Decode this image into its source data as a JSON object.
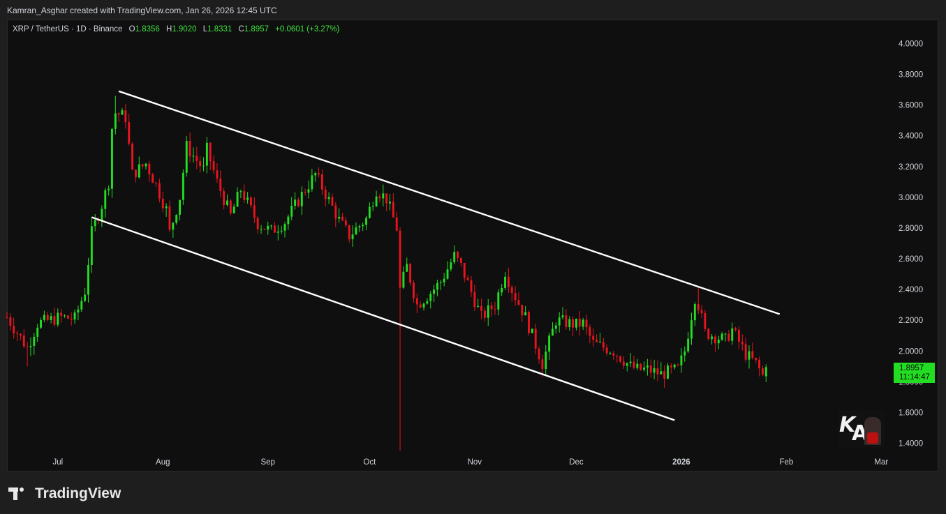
{
  "header": {
    "caption": "Kamran_Asghar created with TradingView.com, Jan 26, 2026 12:45 UTC"
  },
  "legend": {
    "symbol": "XRP / TetherUS · 1D · Binance",
    "open_label": "O",
    "open": "1.8356",
    "high_label": "H",
    "high": "1.9020",
    "low_label": "L",
    "low": "1.8331",
    "close_label": "C",
    "close": "1.8957",
    "change": "+0.0601 (+3.27%)"
  },
  "price_tag": {
    "price": "1.8957",
    "countdown": "11:14:47"
  },
  "watermark": {
    "text": "KAMRAN ASGHAR"
  },
  "brand": {
    "name": "TradingView"
  },
  "colors": {
    "up": "#22dd22",
    "down": "#e8141e",
    "background": "#0f0f0f",
    "channel": "#ffffff",
    "axis_text": "#d1d4dc"
  },
  "chart_data": {
    "type": "candlestick",
    "ylim": [
      1.3,
      4.1
    ],
    "y_ticks": [
      "4.0000",
      "3.8000",
      "3.6000",
      "3.4000",
      "3.2000",
      "3.0000",
      "2.8000",
      "2.6000",
      "2.4000",
      "2.2000",
      "2.0000",
      "1.8000",
      "1.6000",
      "1.4000"
    ],
    "x_ticks": [
      {
        "label": "Jul",
        "date": "2025-07-01"
      },
      {
        "label": "Aug",
        "date": "2025-08-01"
      },
      {
        "label": "Sep",
        "date": "2025-09-01"
      },
      {
        "label": "Oct",
        "date": "2025-10-01"
      },
      {
        "label": "Nov",
        "date": "2025-11-01"
      },
      {
        "label": "Dec",
        "date": "2025-12-01"
      },
      {
        "label": "2026",
        "date": "2026-01-01"
      },
      {
        "label": "Feb",
        "date": "2026-02-01"
      },
      {
        "label": "Mar",
        "date": "2026-03-01"
      }
    ],
    "x_range": [
      "2025-06-16",
      "2026-03-03"
    ],
    "close_anchors": [
      [
        "2025-06-16",
        2.22
      ],
      [
        "2025-06-22",
        2.02
      ],
      [
        "2025-06-25",
        2.18
      ],
      [
        "2025-07-02",
        2.22
      ],
      [
        "2025-07-06",
        2.21
      ],
      [
        "2025-07-09",
        2.39
      ],
      [
        "2025-07-11",
        2.77
      ],
      [
        "2025-07-14",
        2.95
      ],
      [
        "2025-07-16",
        3.1
      ],
      [
        "2025-07-17",
        3.45
      ],
      [
        "2025-07-18",
        3.55
      ],
      [
        "2025-07-21",
        3.52
      ],
      [
        "2025-07-23",
        3.15
      ],
      [
        "2025-07-27",
        3.22
      ],
      [
        "2025-07-30",
        3.08
      ],
      [
        "2025-08-02",
        2.92
      ],
      [
        "2025-08-03",
        2.77
      ],
      [
        "2025-08-06",
        3.0
      ],
      [
        "2025-08-08",
        3.33
      ],
      [
        "2025-08-13",
        3.18
      ],
      [
        "2025-08-14",
        3.31
      ],
      [
        "2025-08-17",
        3.1
      ],
      [
        "2025-08-21",
        2.88
      ],
      [
        "2025-08-24",
        3.05
      ],
      [
        "2025-08-29",
        2.83
      ],
      [
        "2025-09-02",
        2.78
      ],
      [
        "2025-09-06",
        2.84
      ],
      [
        "2025-09-12",
        3.05
      ],
      [
        "2025-09-15",
        3.15
      ],
      [
        "2025-09-19",
        2.98
      ],
      [
        "2025-09-22",
        2.85
      ],
      [
        "2025-09-25",
        2.75
      ],
      [
        "2025-09-30",
        2.86
      ],
      [
        "2025-10-03",
        3.05
      ],
      [
        "2025-10-06",
        2.99
      ],
      [
        "2025-10-09",
        2.8
      ],
      [
        "2025-10-10",
        2.4
      ],
      [
        "2025-10-12",
        2.55
      ],
      [
        "2025-10-15",
        2.3
      ],
      [
        "2025-10-19",
        2.38
      ],
      [
        "2025-10-22",
        2.45
      ],
      [
        "2025-10-26",
        2.62
      ],
      [
        "2025-10-28",
        2.55
      ],
      [
        "2025-11-03",
        2.22
      ],
      [
        "2025-11-07",
        2.3
      ],
      [
        "2025-11-10",
        2.52
      ],
      [
        "2025-11-12",
        2.4
      ],
      [
        "2025-11-16",
        2.22
      ],
      [
        "2025-11-21",
        1.92
      ],
      [
        "2025-11-25",
        2.2
      ],
      [
        "2025-12-01",
        2.17
      ],
      [
        "2025-12-03",
        2.18
      ],
      [
        "2025-12-06",
        2.05
      ],
      [
        "2025-12-12",
        2.0
      ],
      [
        "2025-12-17",
        1.9
      ],
      [
        "2025-12-19",
        1.88
      ],
      [
        "2025-12-22",
        1.88
      ],
      [
        "2025-12-26",
        1.85
      ],
      [
        "2025-12-31",
        1.88
      ],
      [
        "2026-01-02",
        2.0
      ],
      [
        "2026-01-05",
        2.35
      ],
      [
        "2026-01-06",
        2.3
      ],
      [
        "2026-01-08",
        2.12
      ],
      [
        "2026-01-14",
        2.07
      ],
      [
        "2026-01-16",
        2.14
      ],
      [
        "2026-01-20",
        1.98
      ],
      [
        "2026-01-23",
        1.92
      ],
      [
        "2026-01-25",
        1.84
      ],
      [
        "2026-01-26",
        1.8957
      ]
    ],
    "highlights": [
      {
        "date": "2025-07-18",
        "high": 3.66
      },
      {
        "date": "2025-10-10",
        "low": 1.35
      },
      {
        "date": "2026-01-06",
        "high": 2.42
      },
      {
        "date": "2025-11-21",
        "low": 1.83
      },
      {
        "date": "2025-06-22",
        "low": 1.9
      }
    ],
    "channel_lines": [
      {
        "name": "upper",
        "from": [
          "2025-07-19",
          3.69
        ],
        "to": [
          "2026-01-30",
          2.24
        ]
      },
      {
        "name": "lower",
        "from": [
          "2025-07-11",
          2.87
        ],
        "to": [
          "2025-12-30",
          1.55
        ]
      }
    ]
  }
}
